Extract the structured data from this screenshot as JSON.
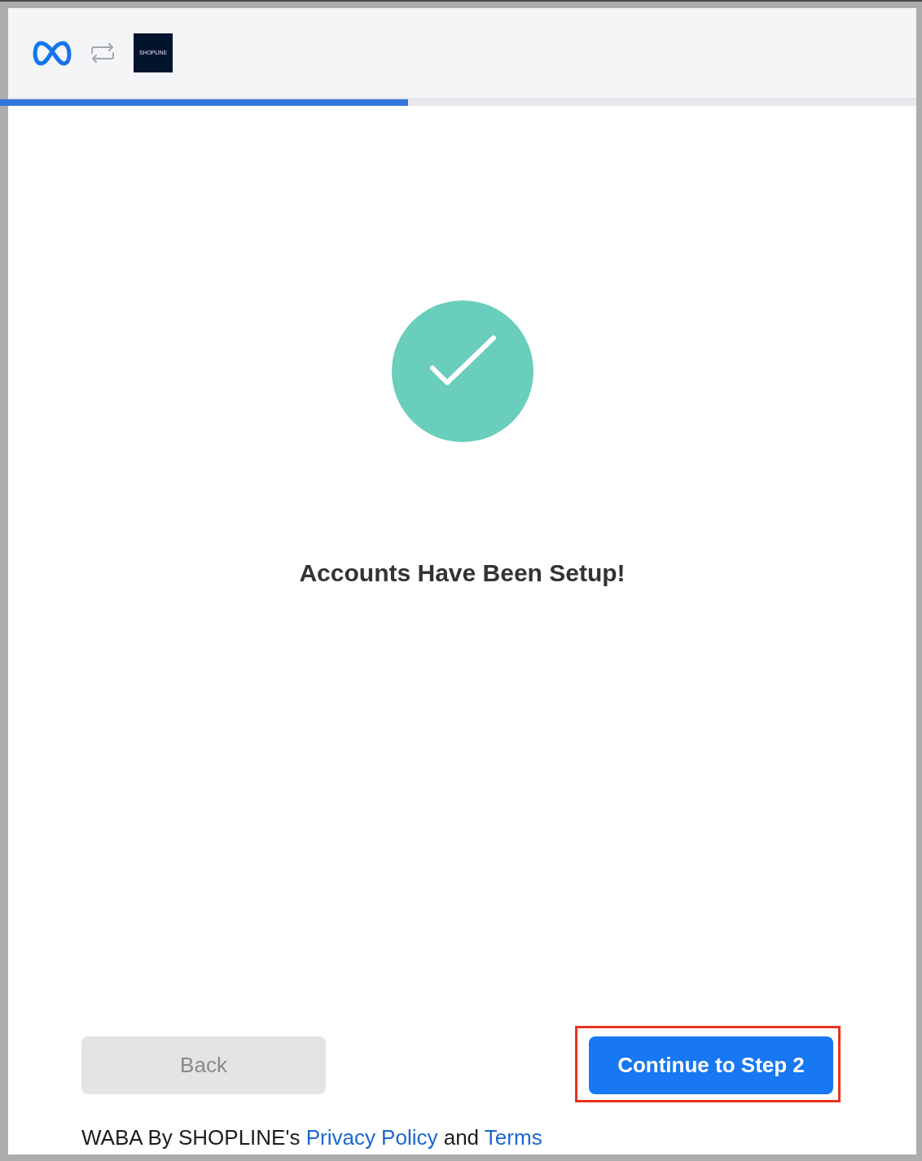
{
  "header": {
    "logos": [
      {
        "kind": "infinity"
      },
      {
        "kind": "swap"
      },
      {
        "kind": "tile",
        "text": "SHOPLINE"
      }
    ]
  },
  "progress": {
    "level": 0.445
  },
  "result": {
    "kind": "success",
    "heading": "Accounts Have Been Setup!"
  },
  "buttons": [
    {
      "label": "Back",
      "kind": "secondary",
      "disabled": true,
      "highlighted": false
    },
    {
      "label": "Continue to Step 2",
      "kind": "primary",
      "disabled": false,
      "highlighted": true
    }
  ],
  "footer": {
    "parts": [
      {
        "kind": "text",
        "text": "WABA By SHOPLINE's"
      },
      {
        "kind": "link",
        "text": "Privacy Policy"
      },
      {
        "kind": "text",
        "text": "and"
      },
      {
        "kind": "link",
        "text": "Terms"
      }
    ]
  }
}
